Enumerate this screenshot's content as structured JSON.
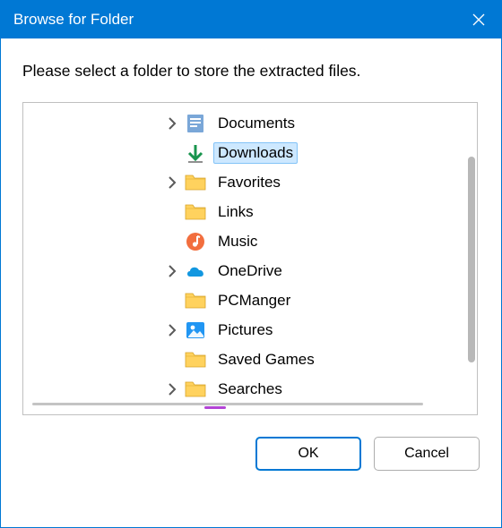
{
  "window": {
    "title": "Browse for Folder"
  },
  "instruction": "Please select a folder to store the extracted files.",
  "tree": {
    "items": [
      {
        "label": "Documents",
        "icon": "documents",
        "expandable": true,
        "selected": false
      },
      {
        "label": "Downloads",
        "icon": "downloads",
        "expandable": false,
        "selected": true
      },
      {
        "label": "Favorites",
        "icon": "folder",
        "expandable": true,
        "selected": false
      },
      {
        "label": "Links",
        "icon": "folder",
        "expandable": false,
        "selected": false
      },
      {
        "label": "Music",
        "icon": "music",
        "expandable": false,
        "selected": false
      },
      {
        "label": "OneDrive",
        "icon": "onedrive",
        "expandable": true,
        "selected": false
      },
      {
        "label": "PCManger",
        "icon": "folder",
        "expandable": false,
        "selected": false
      },
      {
        "label": "Pictures",
        "icon": "pictures",
        "expandable": true,
        "selected": false
      },
      {
        "label": "Saved Games",
        "icon": "folder",
        "expandable": false,
        "selected": false
      },
      {
        "label": "Searches",
        "icon": "folder",
        "expandable": true,
        "selected": false
      }
    ]
  },
  "buttons": {
    "ok": "OK",
    "cancel": "Cancel"
  }
}
